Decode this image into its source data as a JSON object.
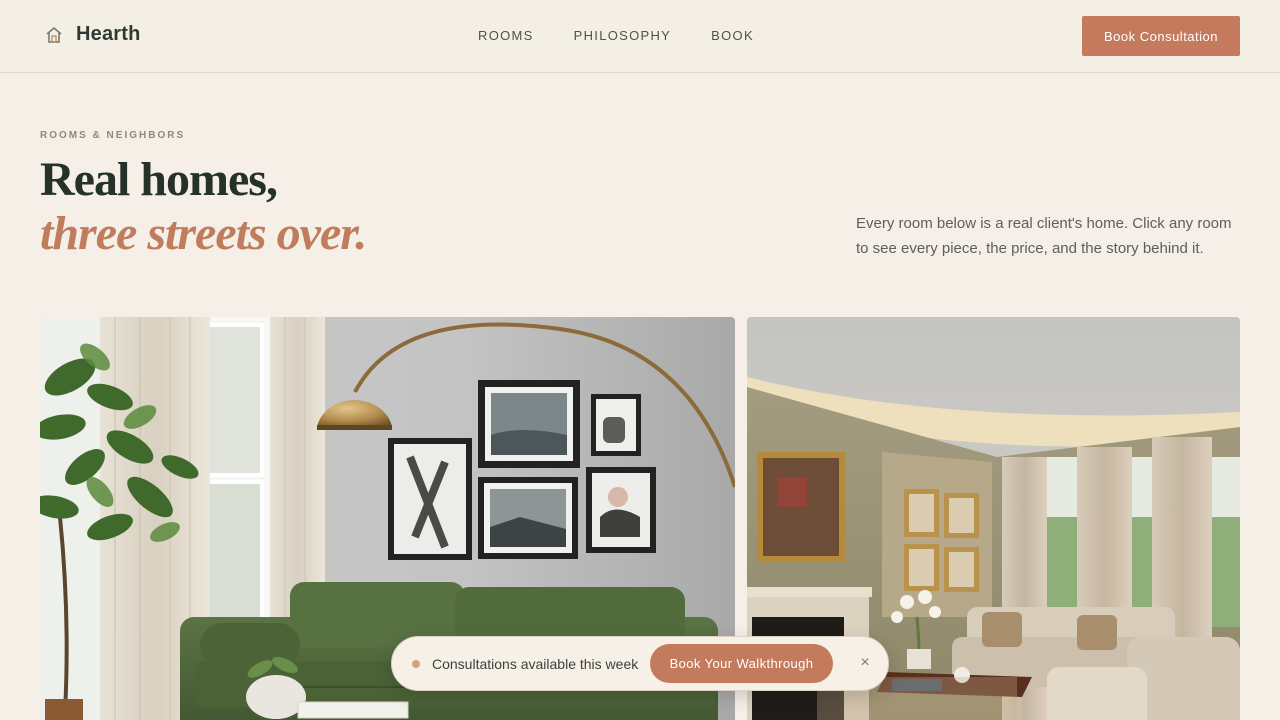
{
  "header": {
    "brand": "Hearth",
    "brand_icon": "house-icon",
    "nav": [
      "ROOMS",
      "PHILOSOPHY",
      "BOOK"
    ],
    "cta": "Book Consultation"
  },
  "hero": {
    "eyebrow": "ROOMS & NEIGHBORS",
    "title_line1": "Real homes,",
    "title_line2": "three streets over.",
    "intro": "Every room below is a real client's home. Click any room to see every piece, the price, and the story behind it."
  },
  "gallery": {
    "left": "living-room-photo",
    "right": "formal-living-room-photo"
  },
  "pill": {
    "status": "Consultations available this week",
    "button": "Book Your Walkthrough",
    "close_icon": "close-icon",
    "close_glyph": "×"
  },
  "colors": {
    "background": "#f5efe7",
    "accent": "#c47a5c",
    "heading": "#253229",
    "italic_accent": "#c07d5e"
  }
}
